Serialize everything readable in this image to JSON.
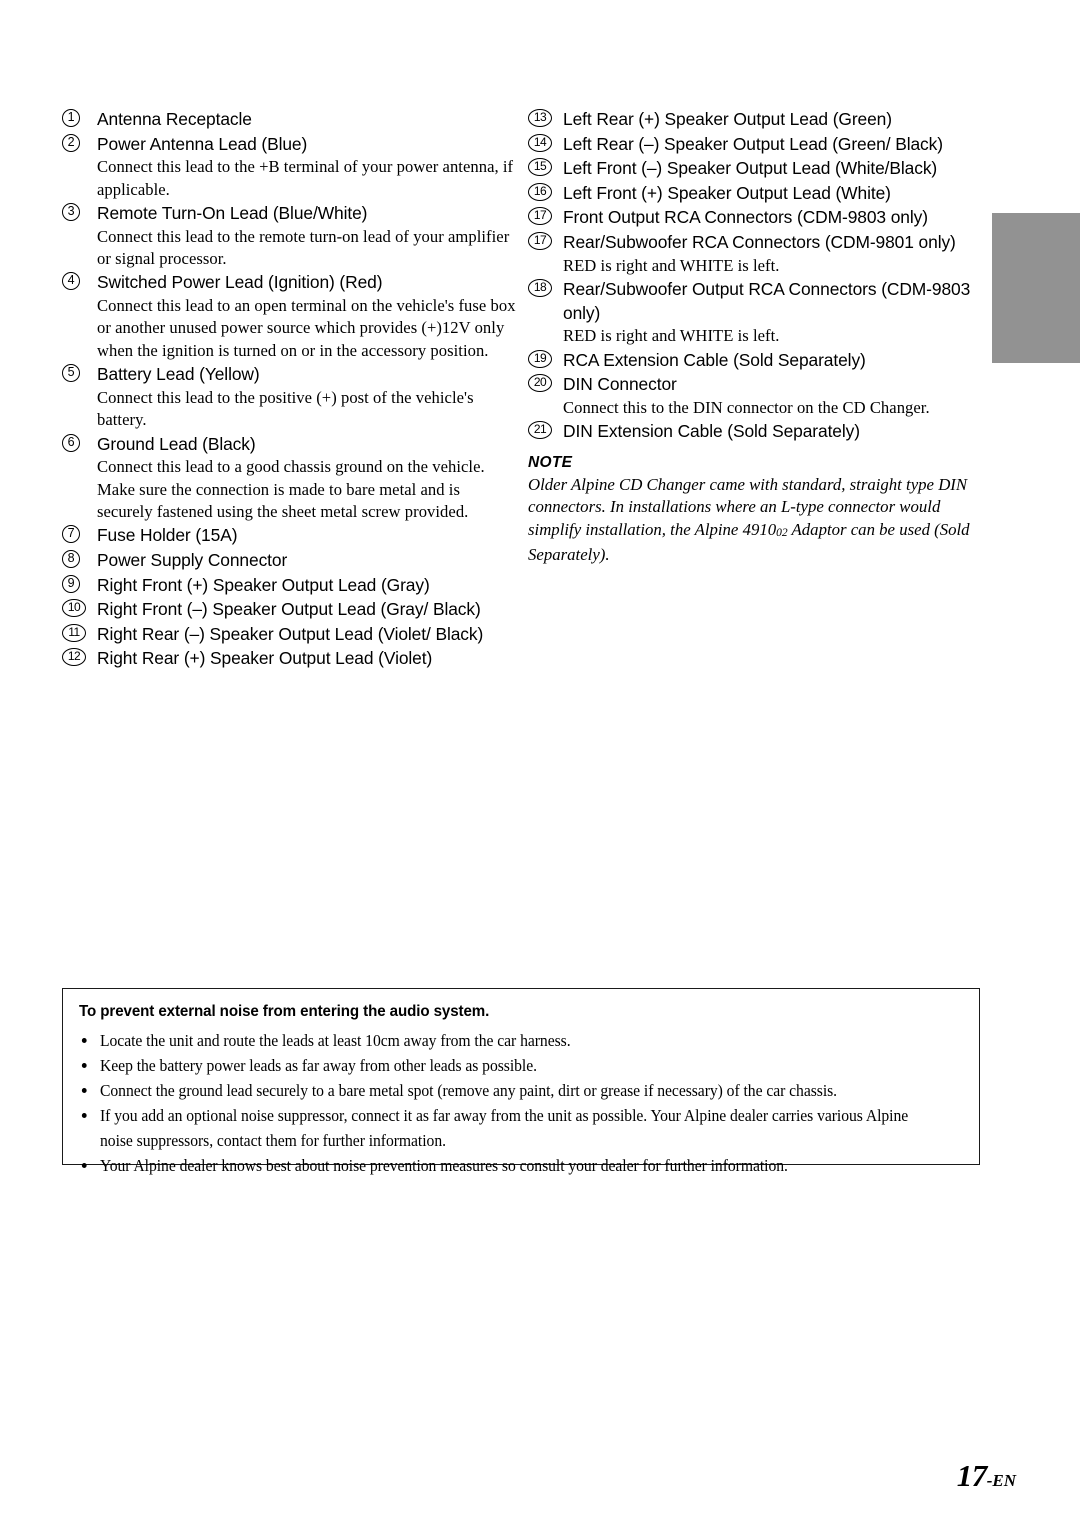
{
  "page": {
    "folio_number": "17",
    "folio_suffix": "-EN"
  },
  "edge_tab": {
    "name": "chapter-thumb-tab",
    "color": "#929292"
  },
  "left_column": [
    {
      "num": "1",
      "heading": "Antenna Receptacle",
      "body": []
    },
    {
      "num": "2",
      "heading": "Power Antenna Lead (Blue)",
      "body": [
        "Connect this lead to the +B terminal of your power antenna, if applicable."
      ]
    },
    {
      "num": "3",
      "heading": "Remote Turn-On Lead (Blue/White)",
      "body": [
        "Connect this lead to the remote turn-on lead of your amplifier or signal processor."
      ]
    },
    {
      "num": "4",
      "heading": "Switched Power Lead (Ignition) (Red)",
      "body": [
        "Connect this lead to an open terminal on the vehicle's fuse box or another unused power source which provides (+)12V only when the ignition is turned on or in the accessory position."
      ]
    },
    {
      "num": "5",
      "heading": "Battery Lead (Yellow)",
      "body": [
        "Connect this lead to the positive (+) post of the vehicle's battery."
      ]
    },
    {
      "num": "6",
      "heading": "Ground Lead (Black)",
      "body": [
        "Connect this lead to a good chassis ground on the vehicle. Make sure the connection is made to bare metal and is securely fastened using the sheet metal screw provided."
      ]
    },
    {
      "num": "7",
      "heading": "Fuse Holder (15A)",
      "body": []
    },
    {
      "num": "8",
      "heading": "Power Supply Connector",
      "body": []
    },
    {
      "num": "9",
      "heading": "Right Front (+) Speaker Output Lead (Gray)",
      "body": []
    },
    {
      "num": "10",
      "heading": "Right Front (–) Speaker Output Lead (Gray/ Black)",
      "body": []
    },
    {
      "num": "11",
      "heading": "Right Rear (–) Speaker Output Lead (Violet/ Black)",
      "body": []
    },
    {
      "num": "12",
      "heading": "Right Rear (+) Speaker Output Lead (Violet)",
      "body": []
    }
  ],
  "right_column": [
    {
      "num": "13",
      "heading": "Left Rear (+) Speaker Output Lead (Green)",
      "body": []
    },
    {
      "num": "14",
      "heading": "Left Rear (–) Speaker Output Lead (Green/ Black)",
      "body": []
    },
    {
      "num": "15",
      "heading": "Left Front (–) Speaker Output Lead (White/Black)",
      "body": []
    },
    {
      "num": "16",
      "heading": "Left Front (+) Speaker Output Lead (White)",
      "body": []
    },
    {
      "num": "17",
      "heading": "Front Output RCA Connectors (CDM-9803 only)",
      "body": []
    },
    {
      "num": "17",
      "heading": "Rear/Subwoofer RCA Connectors (CDM-9801 only)",
      "body": [
        "RED is right and WHITE is left."
      ]
    },
    {
      "num": "18",
      "heading": "Rear/Subwoofer Output RCA Connectors (CDM-9803 only)",
      "body": [
        "RED is right and WHITE is left."
      ]
    },
    {
      "num": "19",
      "heading": "RCA Extension Cable (Sold Separately)",
      "body": []
    },
    {
      "num": "20",
      "heading": "DIN Connector",
      "body": [
        "Connect this to the DIN connector on the CD Changer."
      ]
    },
    {
      "num": "21",
      "heading": "DIN Extension Cable (Sold Separately)",
      "body": []
    }
  ],
  "note": {
    "title": "NOTE",
    "text_before": "Older Alpine CD Changer came with standard, straight type DIN connectors. In installations where an L-type connector would simplify installation, the Alpine 4910",
    "subscript": "02",
    "text_after": " Adaptor can be used (Sold Separately)."
  },
  "noise_box": {
    "title": "To prevent external noise from entering the audio system.",
    "bullets": [
      "Locate the unit and route the leads at least 10cm away from the car harness.",
      "Keep the battery power leads as far away from other leads as possible.",
      "Connect the ground lead securely to a bare metal spot (remove any paint, dirt or grease if necessary) of the car chassis.",
      "If you add an optional noise suppressor, connect it as far away from the unit as possible. Your Alpine dealer carries various Alpine noise suppressors, contact them for further information.",
      "Your Alpine dealer knows best about noise prevention measures so consult your dealer for further information."
    ]
  }
}
